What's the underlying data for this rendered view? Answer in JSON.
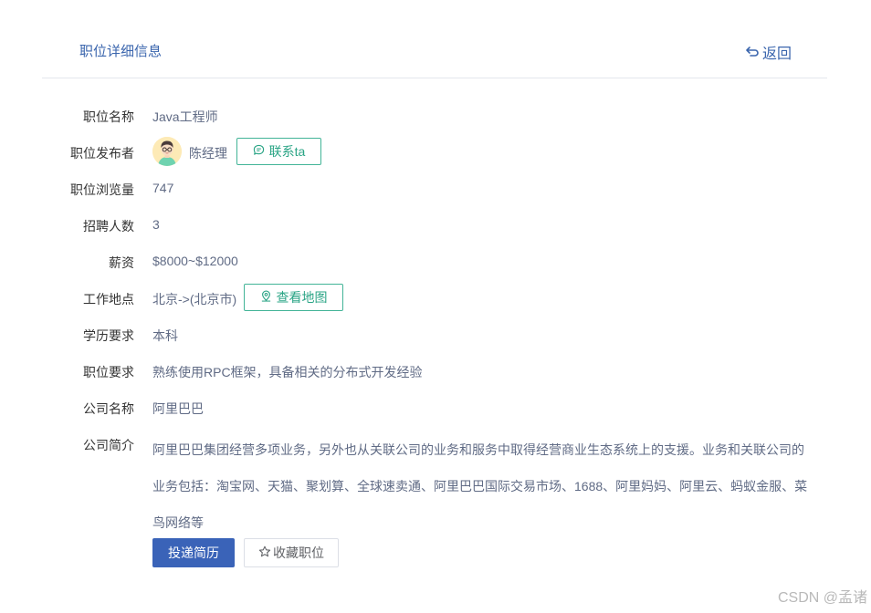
{
  "header": {
    "title": "职位详细信息",
    "back_label": "返回"
  },
  "fields": {
    "position_name": {
      "label": "职位名称",
      "value": "Java工程师"
    },
    "publisher": {
      "label": "职位发布者",
      "name": "陈经理",
      "contact_label": "联系ta"
    },
    "views": {
      "label": "职位浏览量",
      "value": "747"
    },
    "headcount": {
      "label": "招聘人数",
      "value": "3"
    },
    "salary": {
      "label": "薪资",
      "value": "$8000~$12000"
    },
    "location": {
      "label": "工作地点",
      "value": "北京->(北京市)",
      "map_label": "查看地图"
    },
    "education": {
      "label": "学历要求",
      "value": "本科"
    },
    "requirements": {
      "label": "职位要求",
      "value": "熟练使用RPC框架，具备相关的分布式开发经验"
    },
    "company_name": {
      "label": "公司名称",
      "value": "阿里巴巴"
    },
    "company_intro": {
      "label": "公司简介",
      "value": "阿里巴巴集团经营多项业务，另外也从关联公司的业务和服务中取得经营商业生态系统上的支援。业务和关联公司的业务包括：淘宝网、天猫、聚划算、全球速卖通、阿里巴巴国际交易市场、1688、阿里妈妈、阿里云、蚂蚁金服、菜鸟网络等"
    }
  },
  "actions": {
    "submit_label": "投递简历",
    "favorite_label": "收藏职位"
  },
  "watermark": "CSDN @孟诸",
  "colors": {
    "primary": "#3a63b8",
    "accent_green": "#2aa485",
    "title_blue": "#3a65ad"
  },
  "icons": {
    "back": "return-arrow-icon",
    "contact": "chat-bubble-icon",
    "map": "location-pin-icon",
    "favorite": "star-outline-icon"
  }
}
